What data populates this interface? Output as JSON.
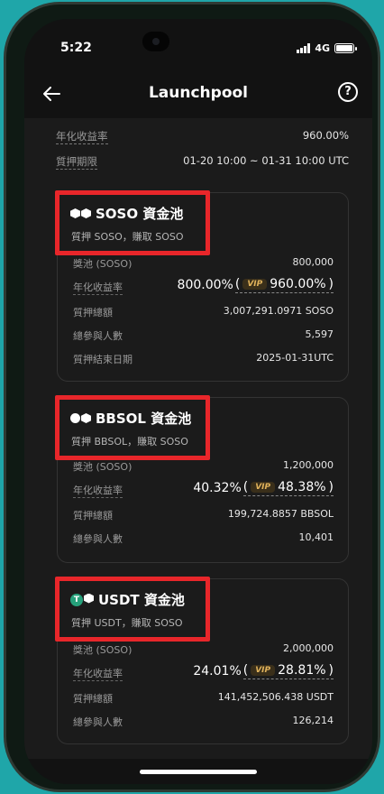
{
  "status": {
    "time": "5:22",
    "network": "4G"
  },
  "nav": {
    "title": "Launchpool",
    "help": "?"
  },
  "top_info": [
    {
      "label": "年化收益率",
      "value": "960.00%"
    },
    {
      "label": "質押期限",
      "value": "01-20 10:00 ~ 01-31 10:00 UTC"
    }
  ],
  "pools": [
    {
      "title": "SOSO 資金池",
      "subtitle": "質押 SOSO，賺取 SOSO",
      "icon": "soso-token-icon",
      "rows": {
        "reward_label": "獎池 (SOSO)",
        "reward_value": "800,000",
        "apr_label": "年化收益率",
        "apr_value": "800.00%",
        "vip_badge": "VIP",
        "vip_apr": "960.00%",
        "staked_label": "質押總額",
        "staked_value": "3,007,291.0971 SOSO",
        "participants_label": "總參與人數",
        "participants_value": "5,597",
        "end_label": "質押結束日期",
        "end_value": "2025-01-31UTC"
      }
    },
    {
      "title": "BBSOL 資金池",
      "subtitle": "質押 BBSOL，賺取 SOSO",
      "icon": "bbsol-token-icon",
      "rows": {
        "reward_label": "獎池 (SOSO)",
        "reward_value": "1,200,000",
        "apr_label": "年化收益率",
        "apr_value": "40.32%",
        "vip_badge": "VIP",
        "vip_apr": "48.38%",
        "staked_label": "質押總額",
        "staked_value": "199,724.8857 BBSOL",
        "participants_label": "總參與人數",
        "participants_value": "10,401"
      }
    },
    {
      "title": "USDT 資金池",
      "subtitle": "質押 USDT，賺取 SOSO",
      "icon": "usdt-token-icon",
      "rows": {
        "reward_label": "獎池 (SOSO)",
        "reward_value": "2,000,000",
        "apr_label": "年化收益率",
        "apr_value": "24.01%",
        "vip_badge": "VIP",
        "vip_apr": "28.81%",
        "staked_label": "質押總額",
        "staked_value": "141,452,506.438 USDT",
        "participants_label": "總參與人數",
        "participants_value": "126,214"
      }
    }
  ],
  "colors": {
    "highlight": "#e8262a",
    "vip": "#e0b25b",
    "background": "#1b1b1b"
  }
}
